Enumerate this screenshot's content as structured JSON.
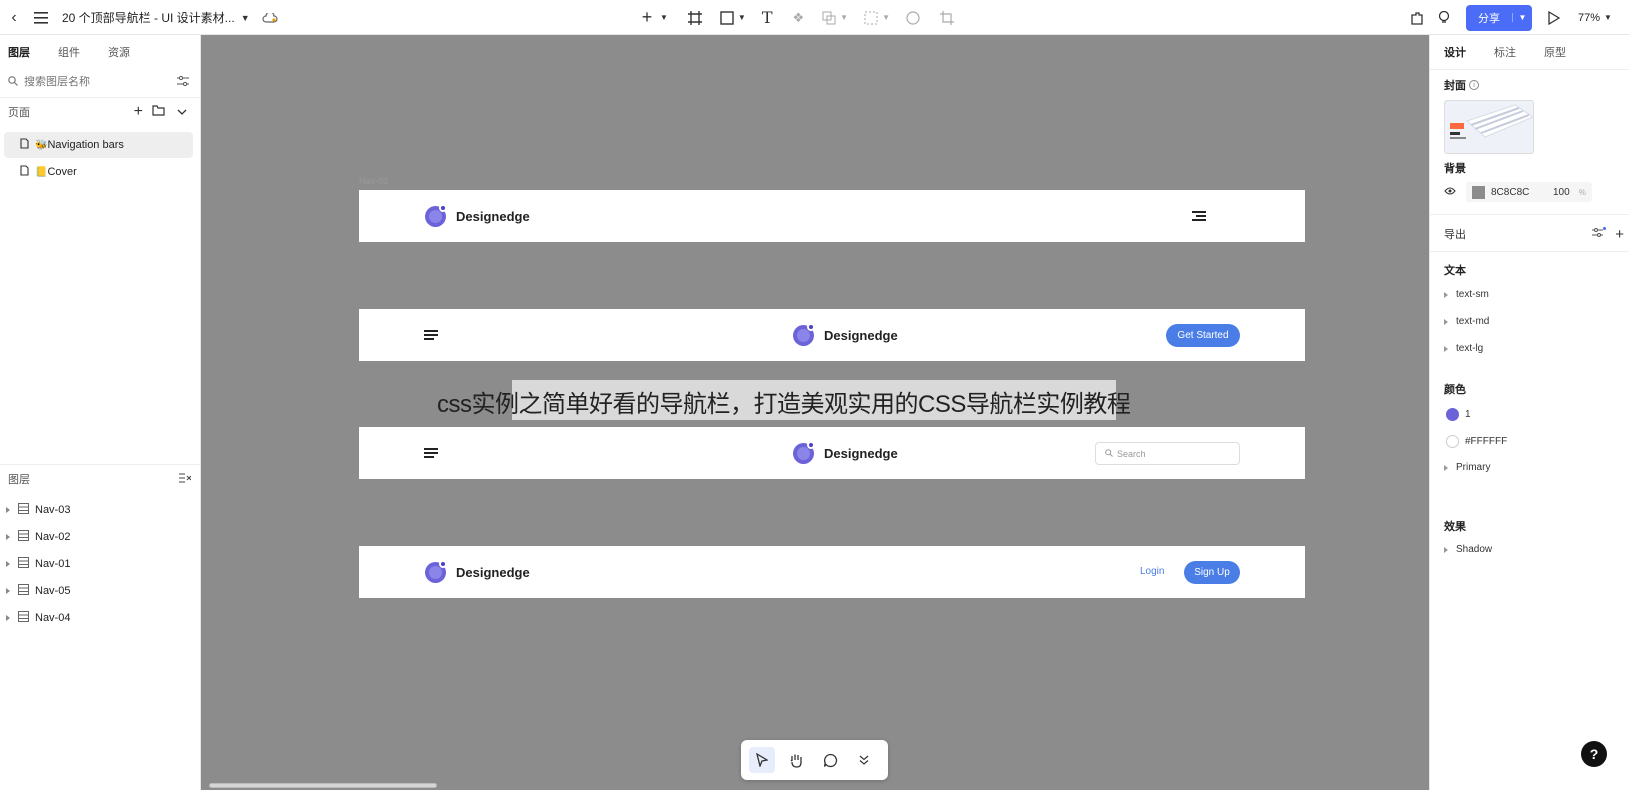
{
  "topbar": {
    "title": "20 个顶部导航栏 - UI 设计素材...",
    "share_label": "分享",
    "zoom": "77%"
  },
  "left": {
    "tabs": [
      "图层",
      "组件",
      "资源"
    ],
    "search_placeholder": "搜索图层名称",
    "pages_label": "页面",
    "pages": [
      {
        "emoji": "🐝",
        "name": "Navigation bars"
      },
      {
        "emoji": "📒",
        "name": "Cover"
      }
    ],
    "layers_label": "图层",
    "layers": [
      "Nav-03",
      "Nav-02",
      "Nav-01",
      "Nav-05",
      "Nav-04"
    ]
  },
  "canvas": {
    "frame_label": "Nav-03",
    "navs": [
      {
        "brand": "Designedge"
      },
      {
        "brand": "Designedge",
        "button": "Get Started"
      },
      {
        "brand": "Designedge",
        "search": "Search"
      },
      {
        "brand": "Designedge",
        "login": "Login",
        "signup": "Sign Up"
      }
    ],
    "overlay_text": "css实例之简单好看的导航栏，打造美观实用的CSS导航栏实例教程"
  },
  "right": {
    "tabs": [
      "设计",
      "标注",
      "原型"
    ],
    "cover_label": "封面",
    "background_label": "背景",
    "bg_hex": "8C8C8C",
    "bg_opacity": "100",
    "bg_opacity_unit": "%",
    "export_label": "导出",
    "text_label": "文本",
    "text_styles": [
      "text-sm",
      "text-md",
      "text-lg"
    ],
    "color_label": "颜色",
    "colors": [
      {
        "name": "1",
        "hex": "#6c63d9"
      },
      {
        "name": "#FFFFFF",
        "hex": "#ffffff"
      }
    ],
    "primary_label": "Primary",
    "effects_label": "效果",
    "effects": [
      "Shadow"
    ]
  },
  "bottom_tools": [
    "pointer-icon",
    "hand-icon",
    "comment-icon",
    "chevron-double-down-icon"
  ],
  "accent": "#4a7ee6"
}
